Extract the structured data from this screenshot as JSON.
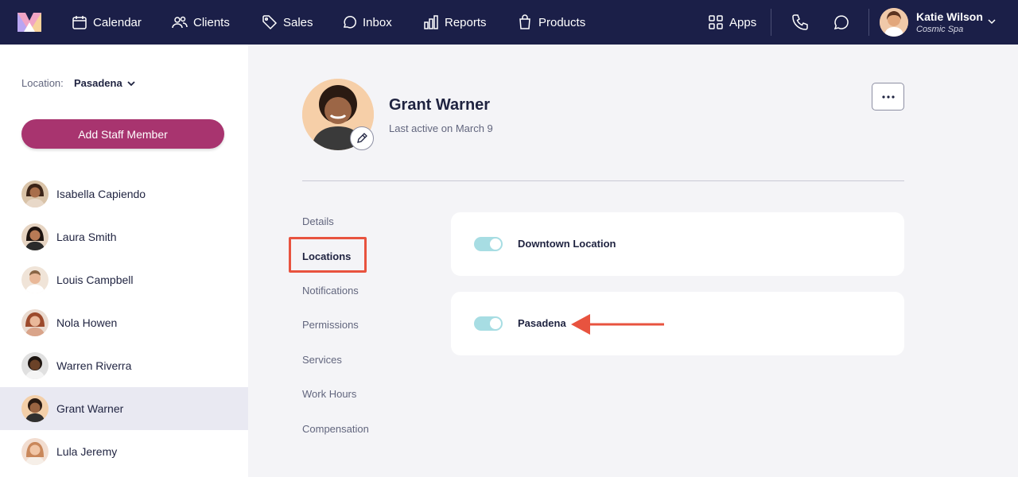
{
  "nav": {
    "items": [
      {
        "label": "Calendar",
        "icon": "calendar-icon"
      },
      {
        "label": "Clients",
        "icon": "clients-icon"
      },
      {
        "label": "Sales",
        "icon": "tag-icon"
      },
      {
        "label": "Inbox",
        "icon": "chat-icon"
      },
      {
        "label": "Reports",
        "icon": "bar-chart-icon"
      },
      {
        "label": "Products",
        "icon": "shopping-bag-icon"
      }
    ],
    "apps_label": "Apps",
    "user": {
      "name": "Katie Wilson",
      "business": "Cosmic Spa"
    }
  },
  "sidebar": {
    "location_label": "Location:",
    "location_value": "Pasadena",
    "add_button": "Add Staff Member",
    "staff": [
      {
        "name": "Isabella Capiendo"
      },
      {
        "name": "Laura Smith"
      },
      {
        "name": "Louis Campbell"
      },
      {
        "name": "Nola Howen"
      },
      {
        "name": "Warren Riverra"
      },
      {
        "name": "Grant Warner",
        "active": true
      },
      {
        "name": "Lula Jeremy"
      }
    ]
  },
  "profile": {
    "name": "Grant Warner",
    "last_active": "Last active on March 9"
  },
  "subnav": {
    "items": [
      "Details",
      "Locations",
      "Notifications",
      "Permissions",
      "Services",
      "Work Hours",
      "Compensation"
    ],
    "active": "Locations"
  },
  "locations": [
    {
      "name": "Downtown Location",
      "enabled": true
    },
    {
      "name": "Pasadena",
      "enabled": true
    }
  ],
  "colors": {
    "nav_bg": "#1b1f48",
    "accent": "#a8346f",
    "toggle_on": "#a7dde3",
    "annotation": "#e8533f"
  }
}
